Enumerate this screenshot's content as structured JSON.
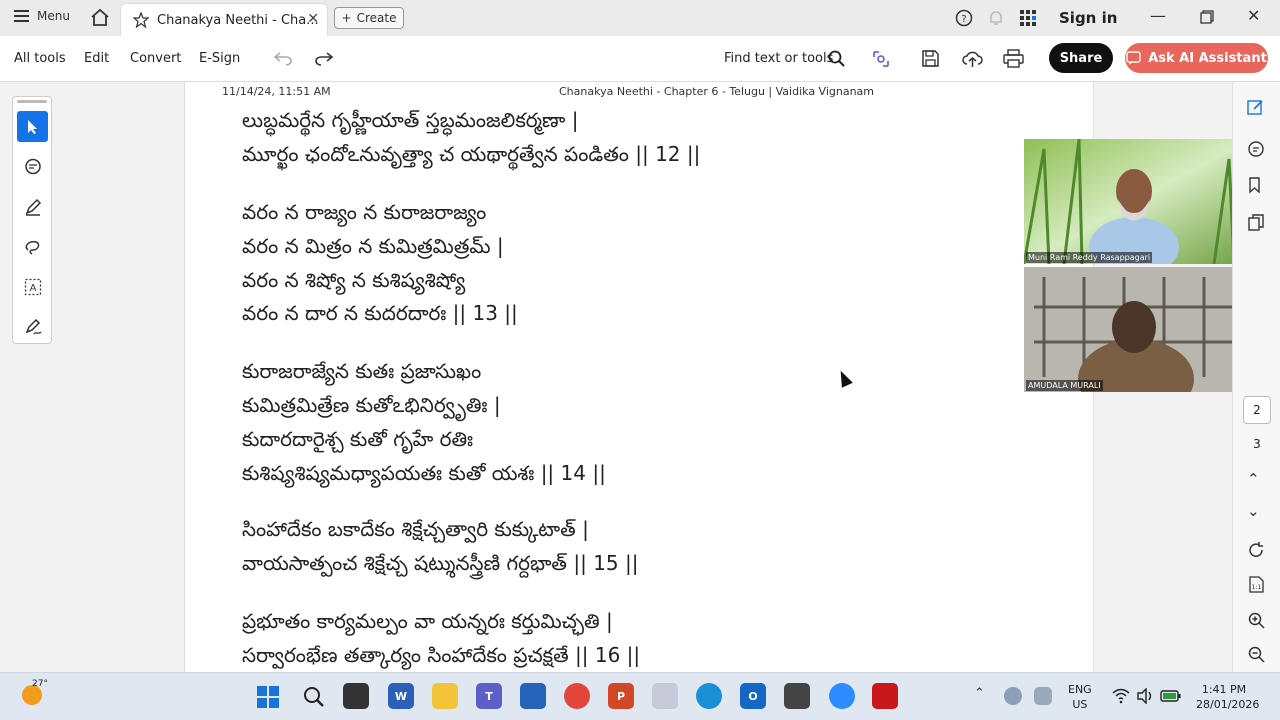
{
  "titlebar": {
    "menu_label": "Menu",
    "tab_title": "Chanakya Neethi - Cha...",
    "create_label": "Create",
    "signin_label": "Sign in"
  },
  "toolbar": {
    "all_tools": "All tools",
    "edit": "Edit",
    "convert": "Convert",
    "esign": "E-Sign",
    "find": "Find text or tools",
    "share": "Share",
    "ask_ai": "Ask AI Assistant"
  },
  "document": {
    "header_datetime": "11/14/24, 11:51 AM",
    "header_title": "Chanakya Neethi - Chapter 6 - Telugu | Vaidika Vignanam",
    "lines": [
      "లుబ్ధమర్థేన గృహ్ణీయాత్ స్తబ్ధమంజలికర్మణా |",
      "మూర్ఖం ఛందోఽనువృత్త్యా చ యథార్థత్వేన పండితం || 12 ||",
      "వరం న రాజ్యం న కురాజరాజ్యం",
      "వరం న మిత్రం న కుమిత్రమిత్రమ్ |",
      "వరం న శిష్యో న కుశిష్యశిష్యో",
      "వరం న దార న కుదరదారః || 13 ||",
      "కురాజరాజ్యేన కుతః ప్రజాసుఖం",
      "కుమిత్రమిత్రేణ కుతోఽభినిర్వృతిః |",
      "కుదారదారైశ్చ కుతో గృహే రతిః",
      "కుశిష్యశిష్యమధ్యాపయతః కుతో యశః || 14 ||",
      "సింహాదేకం బకాదేకం శిక్షేచ్చత్వారి కుక్కుటాత్ |",
      "వాయసాత్పంచ శిక్షేచ్చ షట్శునస్త్రీణి గర్దభాత్ || 15 ||",
      "ప్రభూతం కార్యమల్పం వా యన్నరః కర్తుమిచ్ఛతి |",
      "సర్వారంభేణ తత్కార్యం సింహాదేకం ప్రచక్షతే || 16 ||"
    ]
  },
  "video": {
    "participant1": "Muni Rami Reddy Rasappagari",
    "participant2": "AMUDALA MURALI"
  },
  "rightrail": {
    "page_current": "2",
    "page_next": "3"
  },
  "taskbar": {
    "temperature": "27°",
    "lang_line1": "ENG",
    "lang_line2": "US",
    "time": "1:41 PM",
    "date": "28/01/2026"
  },
  "colors": {
    "accent_blue": "#1473e6",
    "ai_button": "#e8665c",
    "share_button": "#111111"
  }
}
